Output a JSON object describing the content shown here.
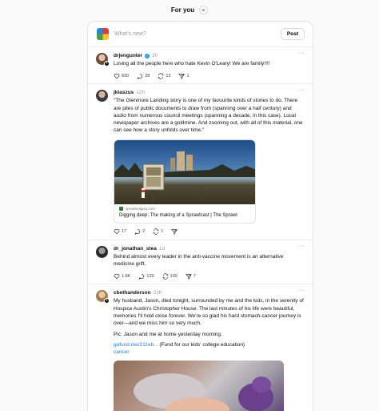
{
  "header": {
    "title": "For you"
  },
  "composer": {
    "placeholder": "What's new?",
    "post_label": "Post"
  },
  "posts": [
    {
      "user": "drjengunter",
      "verified": true,
      "time": "2h",
      "text": "Loving all the people here who hate Kevin O'Leary! We are family!!!!",
      "likes": "830",
      "replies": "28",
      "reposts": "13",
      "shares": "1"
    },
    {
      "user": "jklaszus",
      "time": "12h",
      "text": "\"The Glenmore Landing story is one of my favourite kinds of stories to do. There are piles of public documents to draw from (spanning over a half century) and audio from numerous council meetings (spanning a decade, in this case). Local newspaper archives are a goldmine. And zooming out, with all of this material, one can see how a story unfolds over time.\"",
      "card": {
        "domain": "sprawlcalgary.com",
        "title": "Digging deep: The making of a Sprawlcast | The Sprawl"
      },
      "likes": "17",
      "replies": "2",
      "reposts": "1",
      "shares": ""
    },
    {
      "user": "dr_jonathan_stea",
      "time": "1d",
      "text": "Behind almost every leader in the anti-vaccine movement is an alternative medicine grift.",
      "likes": "1.8K",
      "replies": "129",
      "reposts": "100",
      "shares": "7"
    },
    {
      "user": "cbethanderson",
      "time": "23h",
      "text": "My husband, Jason, died tonight, surrounded by me and the kids, in the serenity of Hospice Austin's Christopher House. The last minutes of his life were beautiful, memories I'll hold close forever. We're so glad his hard stomach-cancer journey is over—and we miss him so very much.",
      "text2": "Pic: Jason and me at home yesterday morning.",
      "link": "gofund.me/211eb...",
      "link_suffix": " (Fund for our kids' college education)",
      "tag": "cancer"
    }
  ]
}
